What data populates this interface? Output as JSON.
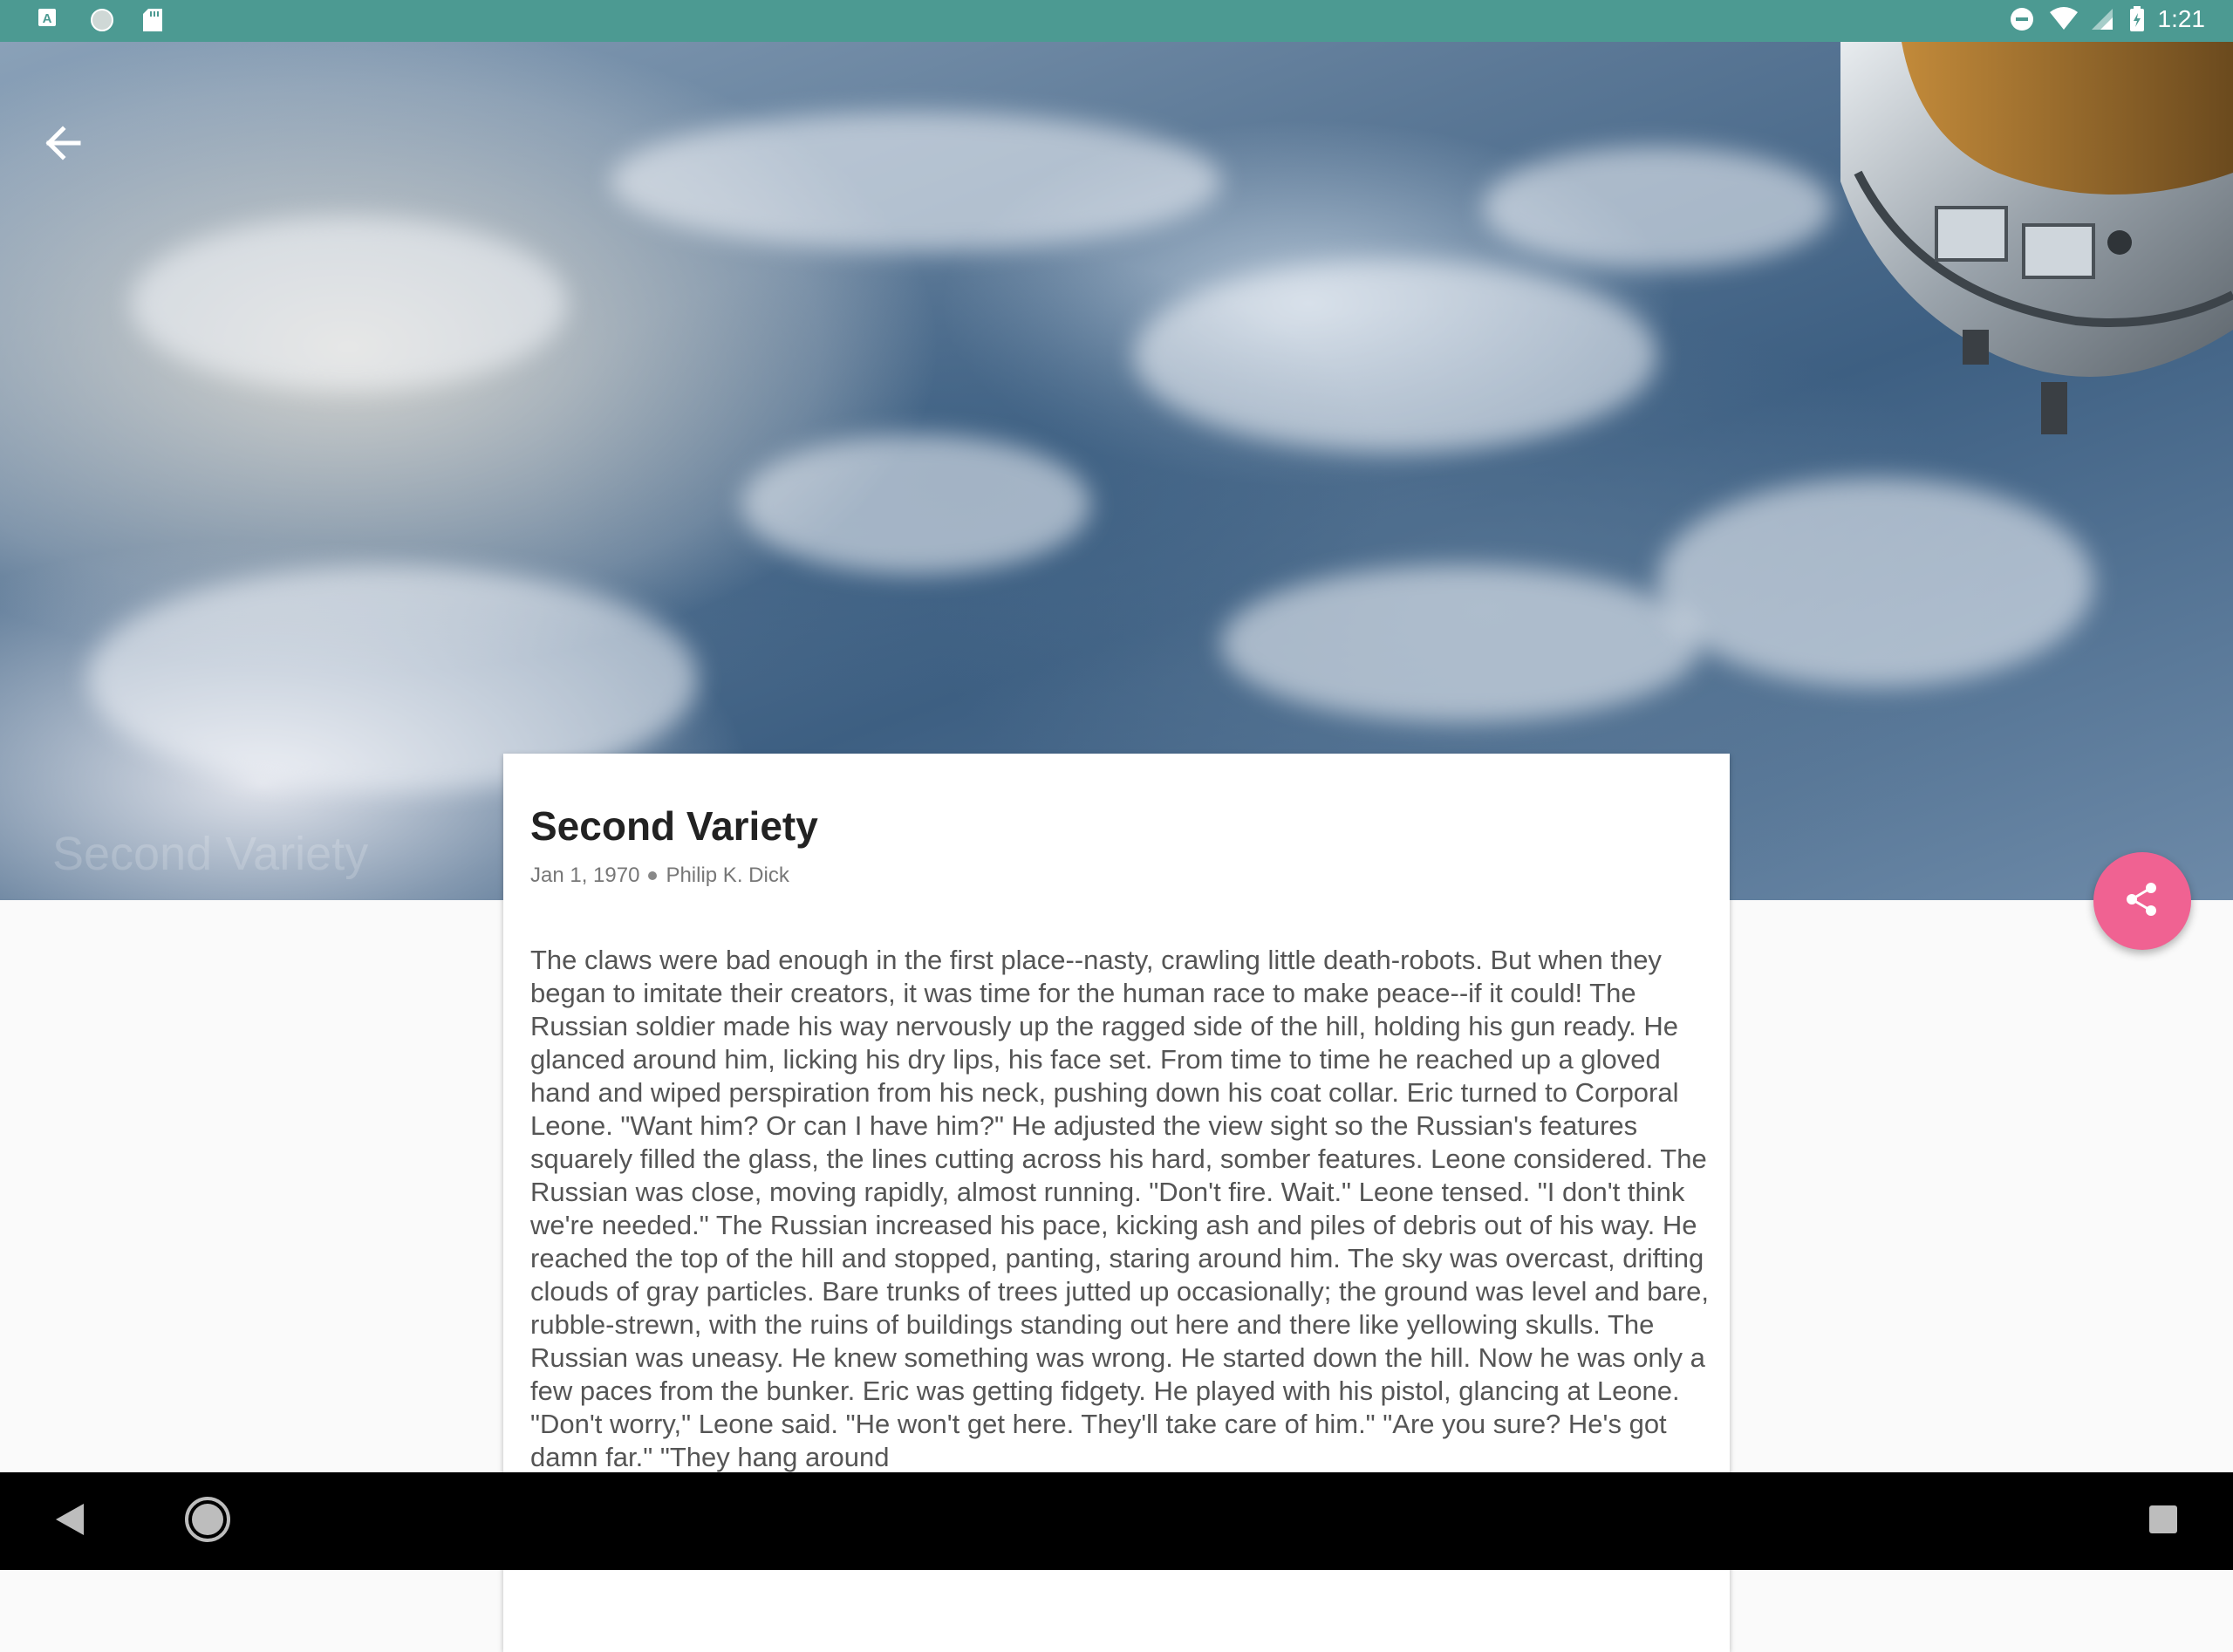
{
  "status_bar": {
    "time": "1:21",
    "left_icons": [
      "a-icon",
      "circle-icon",
      "sd-card-icon"
    ],
    "right_icons": [
      "do-not-disturb-icon",
      "wifi-icon",
      "signal-icon",
      "battery-icon"
    ]
  },
  "hero": {
    "watermark": "Second Variety"
  },
  "article": {
    "title": "Second Variety",
    "date": "Jan 1, 1970",
    "author": "Philip K. Dick",
    "body": "The claws were bad enough in the first place--nasty, crawling little death-robots. But when they began to imitate their creators, it was time for the human race to make peace--if it could! The Russian soldier made his way nervously up the ragged side of the hill, holding his gun ready. He glanced around him, licking his dry lips, his face set. From time to time he reached up a gloved hand and wiped perspiration from his neck, pushing down his coat collar. Eric turned to Corporal Leone. \"Want him? Or can I have him?\" He adjusted the view sight so the Russian's features squarely filled the glass, the lines cutting across his hard, somber features. Leone considered. The Russian was close, moving rapidly, almost running. \"Don't fire. Wait.\" Leone tensed. \"I don't think we're needed.\" The Russian increased his pace, kicking ash and piles of debris out of his way. He reached the top of the hill and stopped, panting, staring around him. The sky was overcast, drifting clouds of gray particles. Bare trunks of trees jutted up occasionally; the ground was level and bare, rubble-strewn, with the ruins of buildings standing out here and there like yellowing skulls. The Russian was uneasy. He knew something was wrong. He started down the hill. Now he was only a few paces from the bunker. Eric was getting fidgety. He played with his pistol, glancing at Leone. \"Don't worry,\" Leone said. \"He won't get here. They'll take care of him.\" \"Are you sure? He's got damn far.\" \"They hang around"
  },
  "colors": {
    "status_bar": "#4c9a92",
    "fab": "#f06292",
    "nav_bar": "#000000"
  },
  "icons": {
    "back": "arrow-back-icon",
    "share": "share-icon",
    "nav_back": "triangle-back-icon",
    "nav_home": "circle-home-icon",
    "nav_recents": "square-recents-icon"
  }
}
